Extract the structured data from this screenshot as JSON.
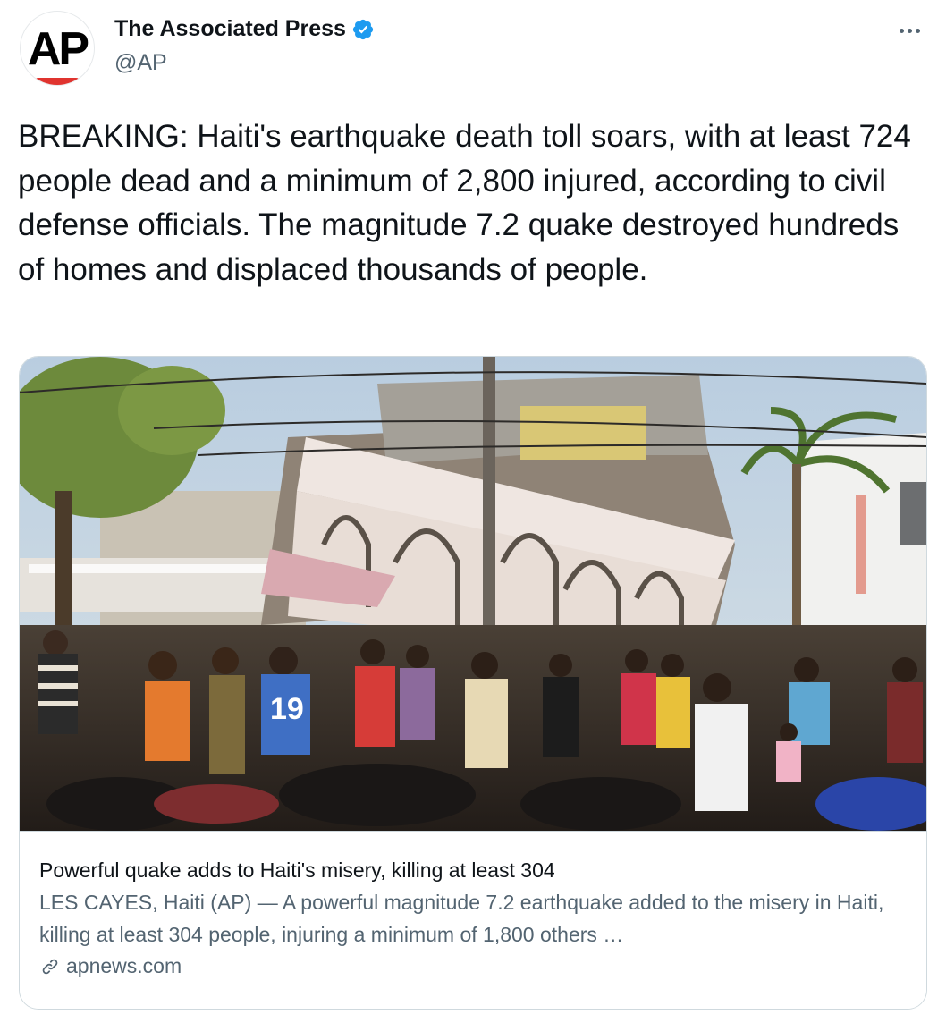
{
  "author": {
    "display_name": "The Associated Press",
    "handle": "@AP",
    "avatar_text": "AP",
    "verified": true
  },
  "tweet": {
    "text": "BREAKING: Haiti's earthquake death toll soars, with at least 724 people dead and a minimum of 2,800 injured, according to civil defense officials. The magnitude 7.2 quake destroyed hundreds of homes and displaced thousands of people."
  },
  "card": {
    "title": "Powerful quake adds to Haiti's misery, killing at least 304",
    "description": "LES CAYES, Haiti (AP) — A powerful magnitude 7.2 earthquake added to the misery in Haiti, killing at least 304 people, injuring a minimum of 1,800 others …",
    "domain": "apnews.com",
    "image_jersey_number": "19"
  },
  "icons": {
    "verified": "verified-badge-icon",
    "more": "more-options-icon",
    "link": "link-icon"
  },
  "colors": {
    "text_primary": "#0f1419",
    "text_secondary": "#536471",
    "verified_blue": "#1d9bf0",
    "border": "#cfd9de",
    "ap_red": "#e0342f"
  }
}
